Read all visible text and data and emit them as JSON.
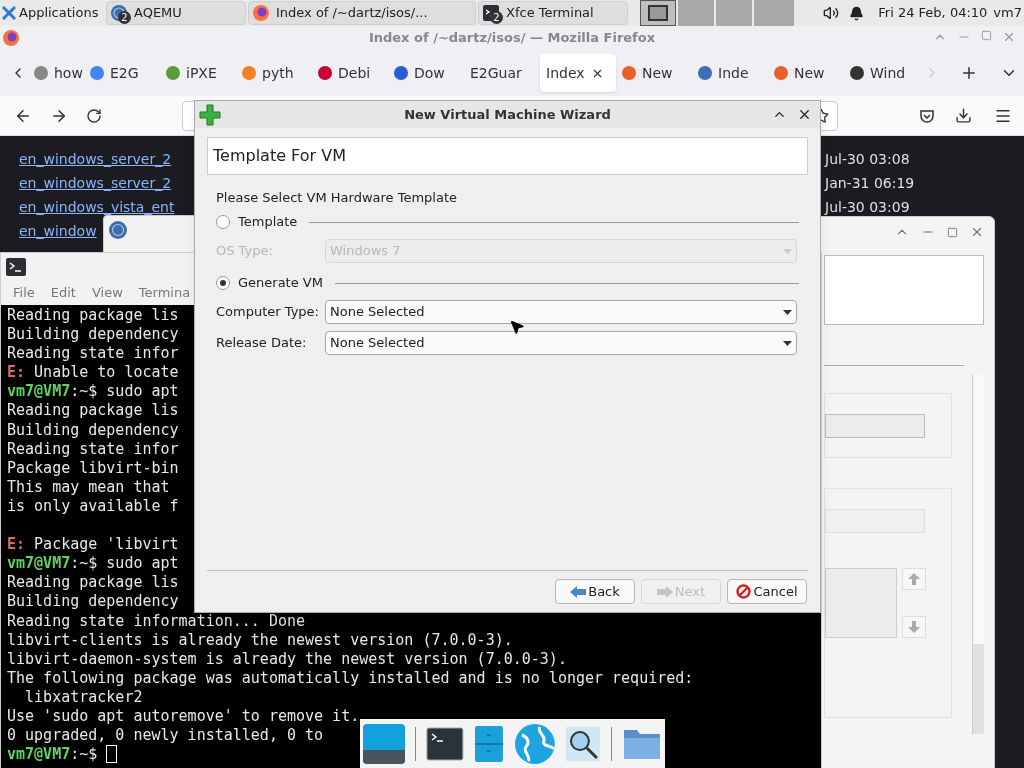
{
  "panel": {
    "apps_label": "Applications",
    "tasks": [
      {
        "kind": "qemu",
        "label": "AQEMU",
        "badge": "2",
        "selected": false
      },
      {
        "kind": "browser",
        "label": "Index of /~dartz/isos/...",
        "selected": false
      },
      {
        "kind": "terminal",
        "label": "Xfce Terminal",
        "badge": "2",
        "selected": false
      }
    ],
    "clock": "Fri 24 Feb, 04:10",
    "user": "vm7"
  },
  "firefox": {
    "title": "Index of /~dartz/isos/ — Mozilla Firefox",
    "tabs": [
      {
        "label": "how",
        "color": "#888888",
        "selected": false
      },
      {
        "label": "E2G",
        "color": "#4285f4",
        "selected": false
      },
      {
        "label": "iPXE",
        "color": "#5a9a3a",
        "selected": false
      },
      {
        "label": "pyth",
        "color": "#f48024",
        "selected": false
      },
      {
        "label": "Debi",
        "color": "#c70036",
        "selected": false
      },
      {
        "label": "Dow",
        "color": "#2a5bd7",
        "selected": false
      },
      {
        "label": "E2Guar",
        "selected": false
      },
      {
        "label": "Index",
        "selected": true
      },
      {
        "label": "New",
        "color": "#e8602c",
        "selected": false
      },
      {
        "label": "Inde",
        "color": "#3c6eb4",
        "selected": false
      },
      {
        "label": "New",
        "color": "#e8602c",
        "selected": false
      },
      {
        "label": "Wind",
        "color": "#333333",
        "selected": false
      }
    ],
    "listing": [
      {
        "name": "en_windows_server_2",
        "date": "Jul-30 03:08"
      },
      {
        "name": "en_windows_server_2",
        "date": "Jan-31 06:19"
      },
      {
        "name": "en_windows_vista_ent",
        "date": "Jul-30 03:09"
      },
      {
        "name": "en_window"
      }
    ]
  },
  "terminal": {
    "menu": [
      "File",
      "Edit",
      "View",
      "Termina"
    ],
    "lines": [
      {
        "kind": "plain",
        "text": "Reading package lis"
      },
      {
        "kind": "plain",
        "text": "Building dependency"
      },
      {
        "kind": "plain",
        "text": "Reading state infor"
      },
      {
        "kind": "error",
        "prefix": "E:",
        "text": " Unable to locate"
      },
      {
        "kind": "prompt",
        "prefix": "vm7@VM7",
        "text": ":~$ sudo apt"
      },
      {
        "kind": "plain",
        "text": "Reading package lis"
      },
      {
        "kind": "plain",
        "text": "Building dependency"
      },
      {
        "kind": "plain",
        "text": "Reading state infor"
      },
      {
        "kind": "plain",
        "text": "Package libvirt-bin"
      },
      {
        "kind": "plain",
        "text": "This may mean that"
      },
      {
        "kind": "plain",
        "text": "is only available f"
      },
      {
        "kind": "blank"
      },
      {
        "kind": "error",
        "prefix": "E:",
        "text": " Package 'libvirt"
      },
      {
        "kind": "prompt",
        "prefix": "vm7@VM7",
        "text": ":~$ sudo apt"
      },
      {
        "kind": "plain",
        "text": "Reading package lis"
      },
      {
        "kind": "plain",
        "text": "Building dependency"
      },
      {
        "kind": "plain",
        "text": "Reading state information... Done"
      },
      {
        "kind": "plain",
        "text": "libvirt-clients is already the newest version (7.0.0-3)."
      },
      {
        "kind": "plain",
        "text": "libvirt-daemon-system is already the newest version (7.0.0-3)."
      },
      {
        "kind": "plain",
        "text": "The following package was automatically installed and is no longer required:"
      },
      {
        "kind": "plain",
        "text": "  libxatracker2"
      },
      {
        "kind": "plain",
        "text": "Use 'sudo apt autoremove' to remove it."
      },
      {
        "kind": "plain",
        "text": "0 upgraded, 0 newly installed, 0 to"
      },
      {
        "kind": "prompt",
        "prefix": "vm7@VM7",
        "text": ":~$ ",
        "cursor": true
      }
    ]
  },
  "wizard": {
    "title": "New Virtual Machine Wizard",
    "heading": "Template For VM",
    "instruction": "Please Select VM Hardware Template",
    "template_option": {
      "label": "Template",
      "selected": false
    },
    "os_type": {
      "label": "OS Type:",
      "value": "Windows 7",
      "disabled": true
    },
    "generate_option": {
      "label": "Generate VM",
      "selected": true
    },
    "fields": [
      {
        "label": "Computer Type:",
        "value": "None Selected",
        "disabled": false
      },
      {
        "label": "Release Date:",
        "value": "None Selected",
        "disabled": false
      }
    ],
    "buttons": [
      {
        "kind": "back",
        "label": "Back",
        "disabled": false
      },
      {
        "kind": "next",
        "label": "Next",
        "disabled": true
      },
      {
        "kind": "cancel",
        "label": "Cancel",
        "disabled": false
      }
    ]
  }
}
